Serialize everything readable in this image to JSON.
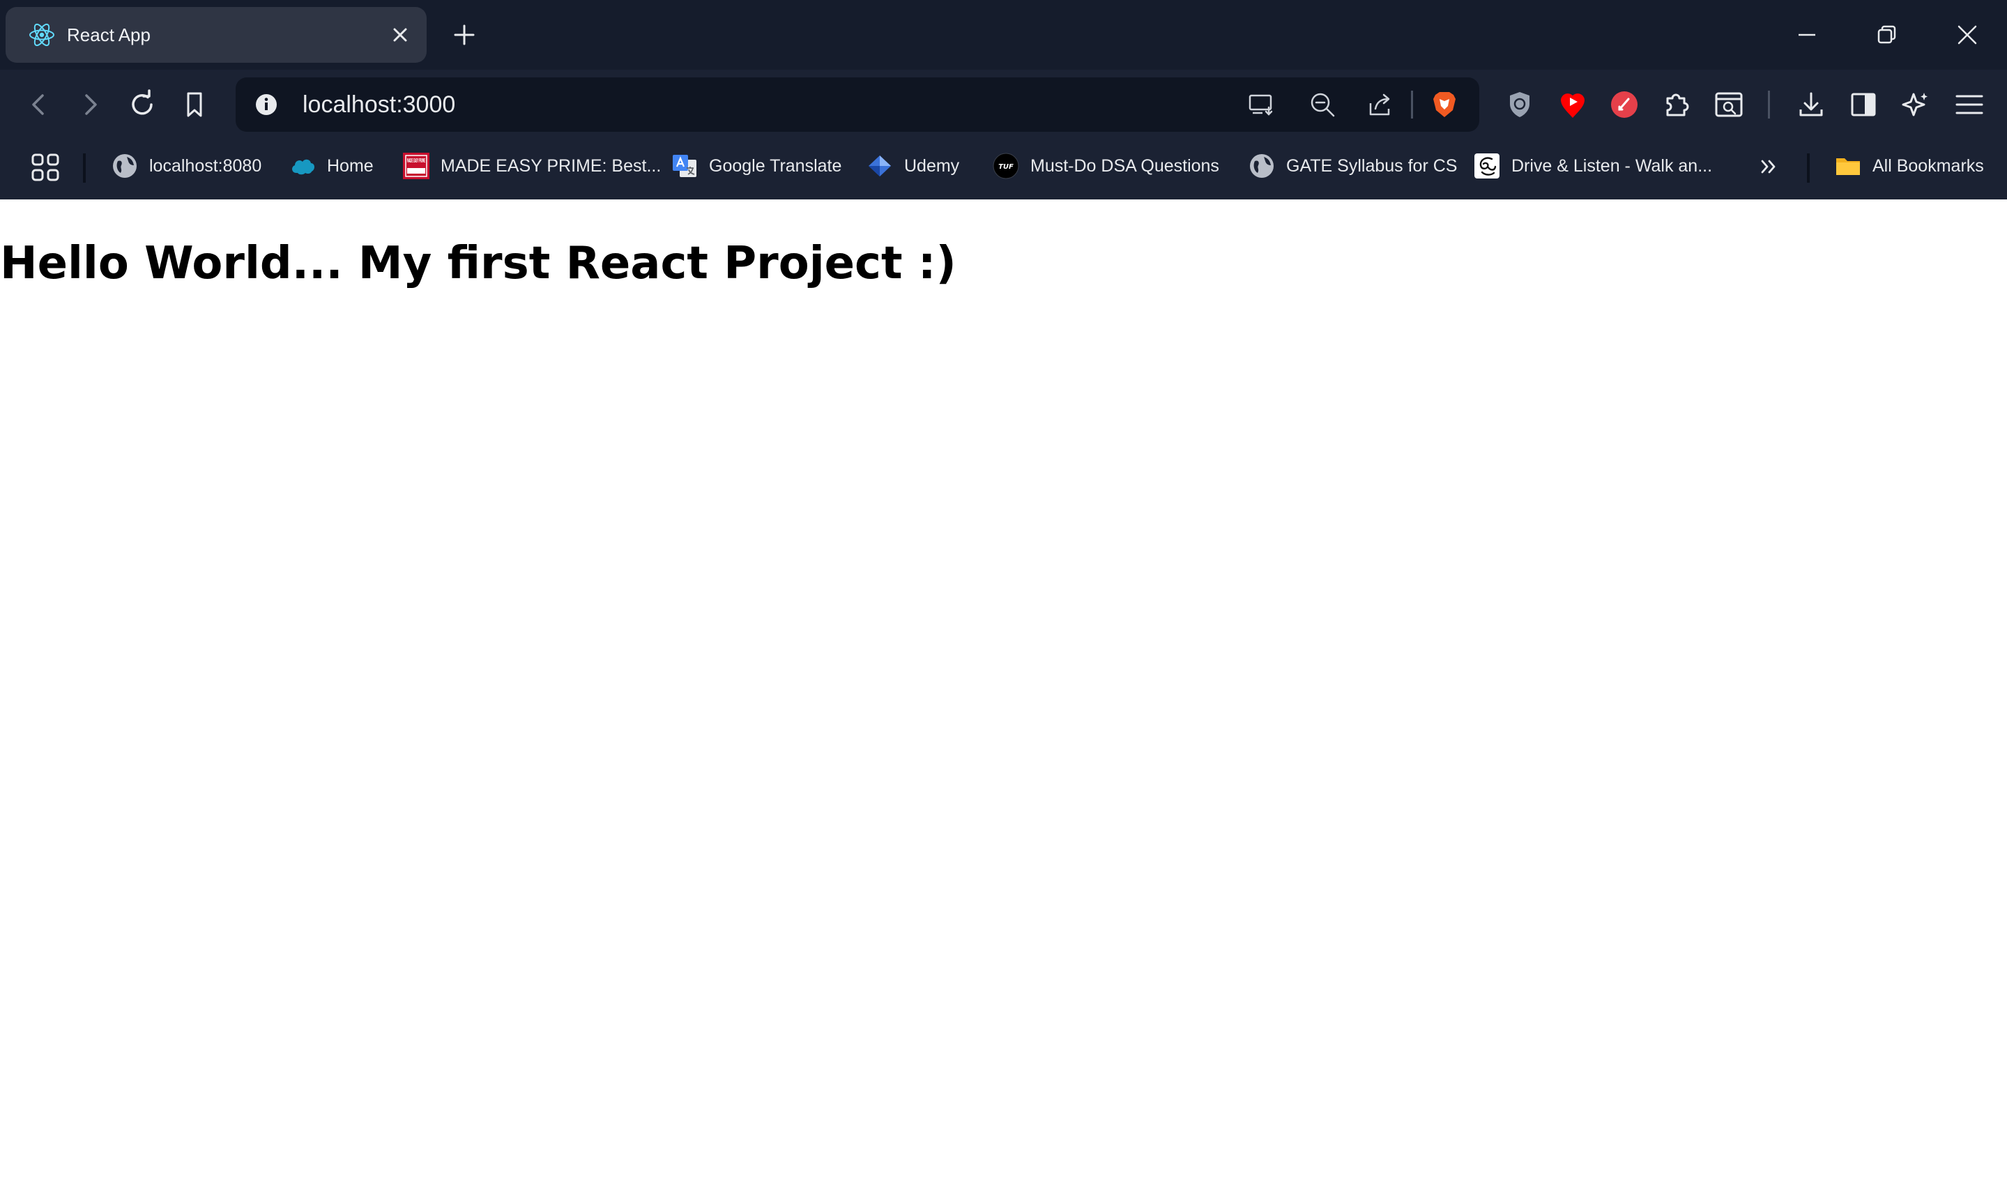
{
  "tab": {
    "title": "React App"
  },
  "address_bar": {
    "url": "localhost:3000"
  },
  "bookmarks": [
    {
      "label": "localhost:8080"
    },
    {
      "label": "Home"
    },
    {
      "label": "MADE EASY PRIME: Best..."
    },
    {
      "label": "Google Translate"
    },
    {
      "label": "Udemy"
    },
    {
      "label": "Must-Do DSA Questions"
    },
    {
      "label": "GATE Syllabus for CS"
    },
    {
      "label": "Drive & Listen - Walk an..."
    }
  ],
  "all_bookmarks_label": "All Bookmarks",
  "bookmark_icon_text": {
    "made_easy": "MADE EASY PRIME",
    "tuf": "TUF"
  },
  "page": {
    "heading": "Hello World... My first React Project :)"
  },
  "colors": {
    "tab_strip_bg": "#151c2c",
    "toolbar_bg": "#1b2233",
    "active_tab_bg": "#2f3544",
    "omnibox_bg": "#0f1522",
    "brave_orange": "#f15a22",
    "react_cyan": "#61dafb",
    "page_bg": "#ffffff"
  },
  "icons": [
    "react-logo-icon",
    "tab-close-icon",
    "new-tab-icon",
    "minimize-icon",
    "restore-icon",
    "window-close-icon",
    "back-icon",
    "forward-icon",
    "reload-icon",
    "bookmark-page-icon",
    "site-info-icon",
    "cast-icon",
    "zoom-out-icon",
    "share-icon",
    "brave-shields-icon",
    "vpn-shield-icon",
    "youtube-extension-icon",
    "pdf-extension-icon",
    "extensions-icon",
    "screenshot-icon",
    "downloads-icon",
    "sidebar-icon",
    "leo-ai-icon",
    "menu-icon",
    "apps-grid-icon",
    "globe-icon",
    "salesforce-cloud-icon",
    "made-easy-icon",
    "google-translate-icon",
    "udemy-icon",
    "tuf-icon",
    "drive-listen-icon",
    "chevron-double-right-icon",
    "folder-icon"
  ]
}
